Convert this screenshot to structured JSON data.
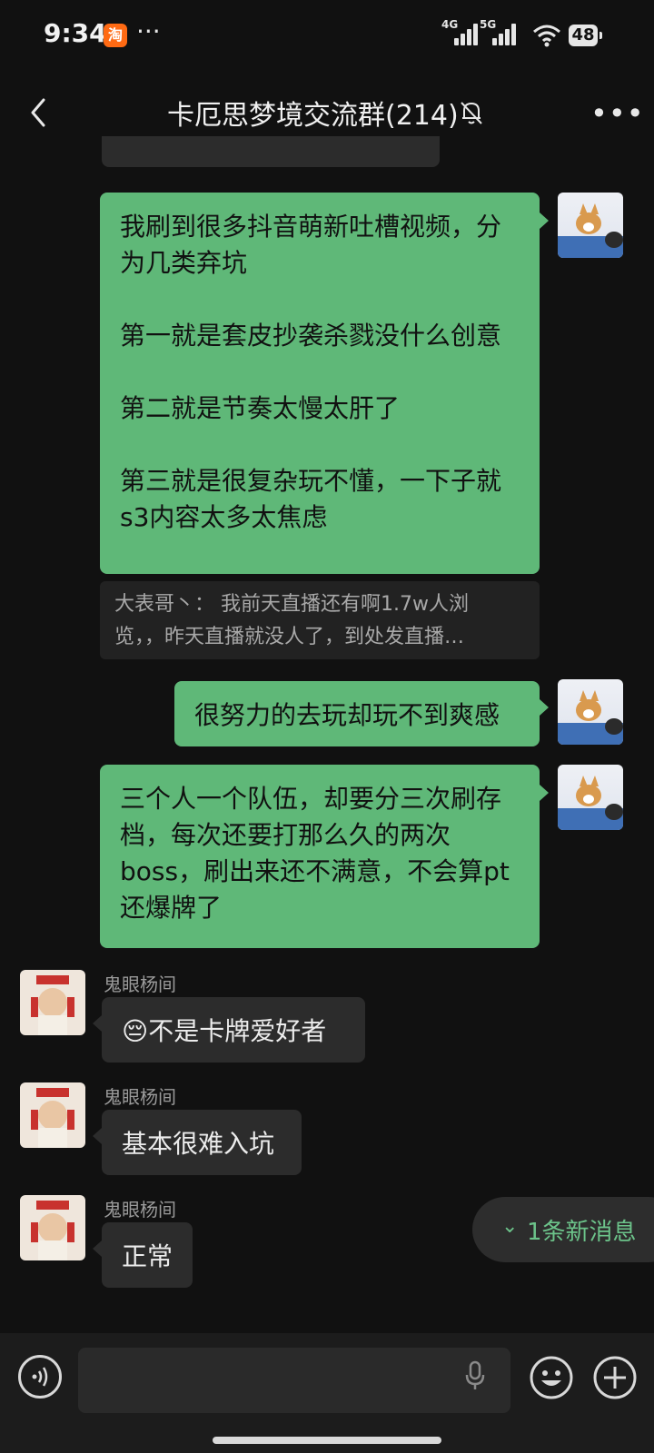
{
  "status_bar": {
    "time": "9:34",
    "app_badge": "淘",
    "more": "···",
    "network1": "4G",
    "network2": "5G",
    "battery": "48"
  },
  "header": {
    "title": "卡厄思梦境交流群(214)"
  },
  "messages": [
    {
      "side": "right",
      "text": "我刷到很多抖音萌新吐槽视频，分\n为几类弃坑\n\n第一就是套皮抄袭杀戮没什么创意\n\n第二就是节奏太慢太肝了\n\n第三就是很复杂玩不懂，一下子就\ns3内容太多太焦虑"
    },
    {
      "side": "right",
      "text": "很努力的去玩却玩不到爽感"
    },
    {
      "side": "right",
      "text": "三个人一个队伍，却要分三次刷存\n档，每次还要打那么久的两次\nboss，刷出来还不满意，不会算pt\n还爆牌了"
    },
    {
      "side": "left",
      "sender": "鬼眼杨间",
      "text": "😔不是卡牌爱好者"
    },
    {
      "side": "left",
      "sender": "鬼眼杨间",
      "text": "基本很难入坑"
    },
    {
      "side": "left",
      "sender": "鬼眼杨间",
      "text": "正常"
    }
  ],
  "quote": {
    "line1": "大表哥丶： 我前天直播还有啊1.7w人浏",
    "line2": "览，，昨天直播就没人了，到处发直播…"
  },
  "new_messages_pill": {
    "label": "1条新消息"
  },
  "colors": {
    "background": "#111111",
    "my_bubble": "#5fb878",
    "other_bubble": "#2c2c2c",
    "accent_green": "#6cc38a"
  }
}
